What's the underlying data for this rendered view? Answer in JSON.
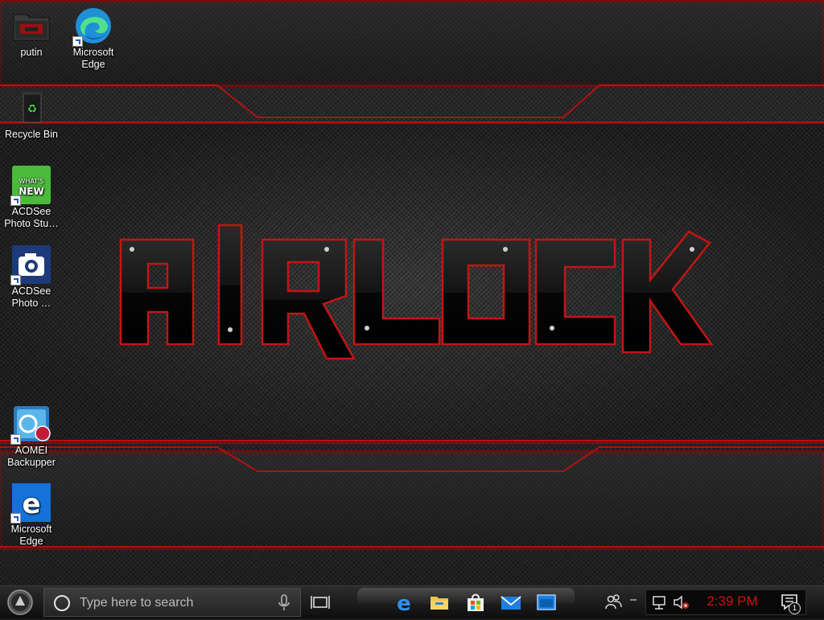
{
  "desktop": {
    "icons": [
      {
        "id": "putin",
        "label": "putin"
      },
      {
        "id": "edge-top",
        "label": "Microsoft Edge"
      },
      {
        "id": "recycle",
        "label": "Recycle Bin"
      },
      {
        "id": "acdsee-studio",
        "label": "ACDSee Photo Stu…"
      },
      {
        "id": "acdsee-photo",
        "label": "ACDSee Photo …"
      },
      {
        "id": "aomei",
        "label": "AOMEI Backupper"
      },
      {
        "id": "edge-bottom",
        "label": "Microsoft Edge"
      }
    ],
    "wallpaper_text": "AIRLOCK",
    "accent_color": "#b01010"
  },
  "taskbar": {
    "search_placeholder": "Type here to search",
    "pinned_apps": [
      "edge-icon",
      "file-explorer-icon",
      "store-icon",
      "mail-icon",
      "window-icon"
    ],
    "clock": "2:39 PM",
    "notification_count": "1"
  }
}
